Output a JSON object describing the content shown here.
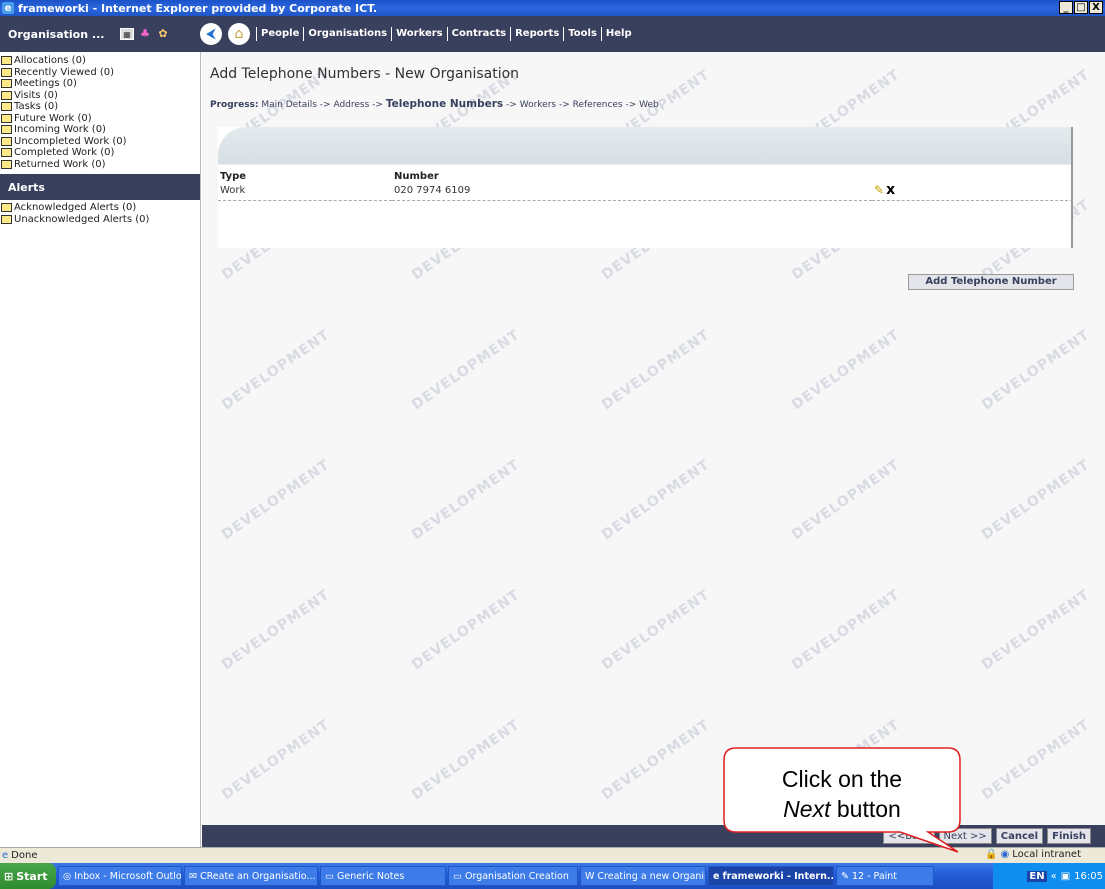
{
  "window": {
    "title": "frameworki - Internet Explorer provided by Corporate ICT.",
    "controls": [
      "_",
      "□",
      "X"
    ]
  },
  "nav": {
    "brand": "Organisation ...",
    "menu": [
      "People",
      "Organisations",
      "Workers",
      "Contracts",
      "Reports",
      "Tools",
      "Help"
    ]
  },
  "sidebar": {
    "folders": [
      "Allocations (0)",
      "Recently Viewed (0)",
      "Meetings (0)",
      "Visits (0)",
      "Tasks (0)",
      "Future Work (0)",
      "Incoming Work (0)",
      "Uncompleted Work (0)",
      "Completed Work (0)",
      "Returned Work (0)"
    ],
    "alerts_title": "Alerts",
    "alerts": [
      "Acknowledged Alerts (0)",
      "Unacknowledged Alerts (0)"
    ]
  },
  "main": {
    "title": "Add Telephone Numbers - New Organisation",
    "progress": {
      "label": "Progress:",
      "before": "Main Details -> Address ->",
      "current": "Telephone Numbers",
      "after": "-> Workers -> References -> Web"
    },
    "table": {
      "headers": [
        "Type",
        "Number"
      ],
      "rows": [
        {
          "type": "Work",
          "number": "020 7974 6109"
        }
      ]
    },
    "add_button": "Add Telephone Number",
    "watermark": "DEVELOPMENT"
  },
  "footer_buttons": {
    "back": "<<Back",
    "next": "Next >>",
    "cancel": "Cancel",
    "finish": "Finish"
  },
  "status": {
    "text": "Done",
    "zone": "Local intranet"
  },
  "taskbar": {
    "start": "Start",
    "tasks": [
      "Inbox - Microsoft Outlook",
      "CReate an Organisatio...",
      "Generic Notes",
      "Organisation Creation",
      "Creating a new Organis...",
      "frameworki - Intern...",
      "12 - Paint"
    ],
    "active_task": 5,
    "lang": "EN",
    "clock": "16:05"
  },
  "callout": {
    "line1": "Click on the",
    "italic": "Next",
    "rest": " button"
  }
}
